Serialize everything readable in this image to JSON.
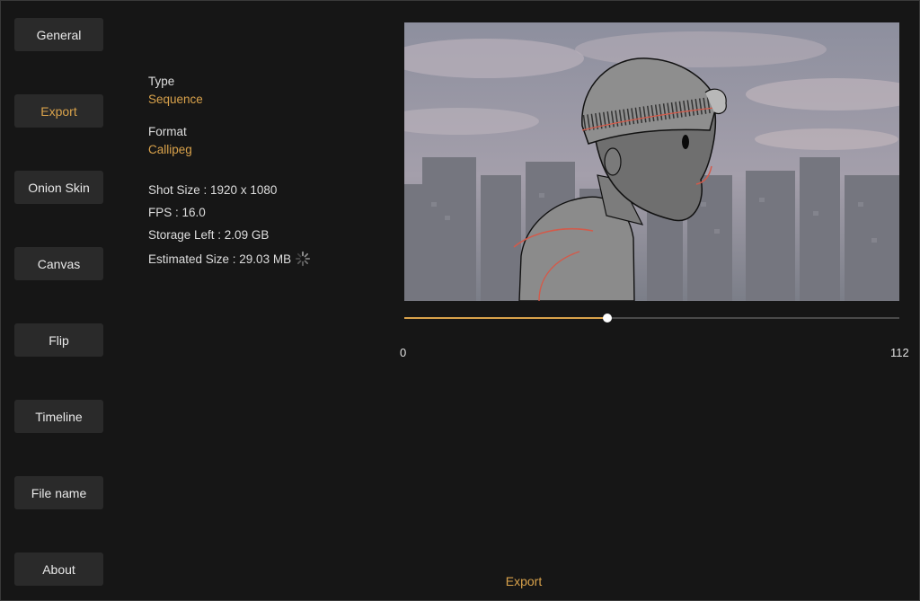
{
  "sidebar": {
    "items": [
      {
        "label": "General",
        "active": false
      },
      {
        "label": "Export",
        "active": true
      },
      {
        "label": "Onion Skin",
        "active": false
      },
      {
        "label": "Canvas",
        "active": false
      },
      {
        "label": "Flip",
        "active": false
      },
      {
        "label": "Timeline",
        "active": false
      },
      {
        "label": "File name",
        "active": false
      },
      {
        "label": "About",
        "active": false
      }
    ]
  },
  "export_settings": {
    "type_label": "Type",
    "type_value": "Sequence",
    "format_label": "Format",
    "format_value": "Callipeg",
    "shot_size": "Shot Size :  1920 x 1080",
    "fps": "FPS :  16.0",
    "storage_left": "Storage Left : 2.09 GB",
    "estimated_size": "Estimated Size : 29.03 MB"
  },
  "timeline": {
    "min": "0",
    "max": "112",
    "current_frame": 46,
    "total_frames": 112
  },
  "export_button_label": "Export",
  "colors": {
    "accent": "#d9a24b",
    "background": "#161616",
    "button_bg": "#2a2a2a"
  }
}
